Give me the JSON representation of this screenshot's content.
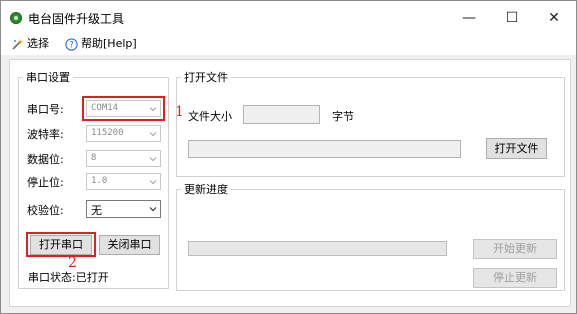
{
  "window": {
    "title": "电台固件升级工具",
    "minimize_glyph": "—",
    "maximize_glyph": "☐",
    "close_glyph": "✕"
  },
  "menu": {
    "select_label": "选择",
    "help_label": "帮助[Help]"
  },
  "serial_group": {
    "title": "串口设置",
    "port": {
      "label": "串口号:",
      "value": "COM14"
    },
    "baud": {
      "label": "波特率:",
      "value": "115200"
    },
    "data_bits": {
      "label": "数据位:",
      "value": "8"
    },
    "stop_bits": {
      "label": "停止位:",
      "value": "1.0"
    },
    "parity": {
      "label": "校验位:",
      "value": "无"
    },
    "open_button": "打开串口",
    "close_button": "关闭串口",
    "status_label": "串口状态:",
    "status_value": "已打开"
  },
  "file_group": {
    "title": "打开文件",
    "size_label": "文件大小",
    "size_value": "",
    "unit_label": "字节",
    "path_value": "",
    "open_file_button": "打开文件"
  },
  "update_group": {
    "title": "更新进度",
    "progress": 0,
    "start_button": "开始更新",
    "stop_button": "停止更新"
  },
  "annotations": {
    "marker_1": "1",
    "marker_2": "2"
  },
  "colors": {
    "annotation_red": "#e02020",
    "app_icon_green": "#2e8b2e"
  }
}
